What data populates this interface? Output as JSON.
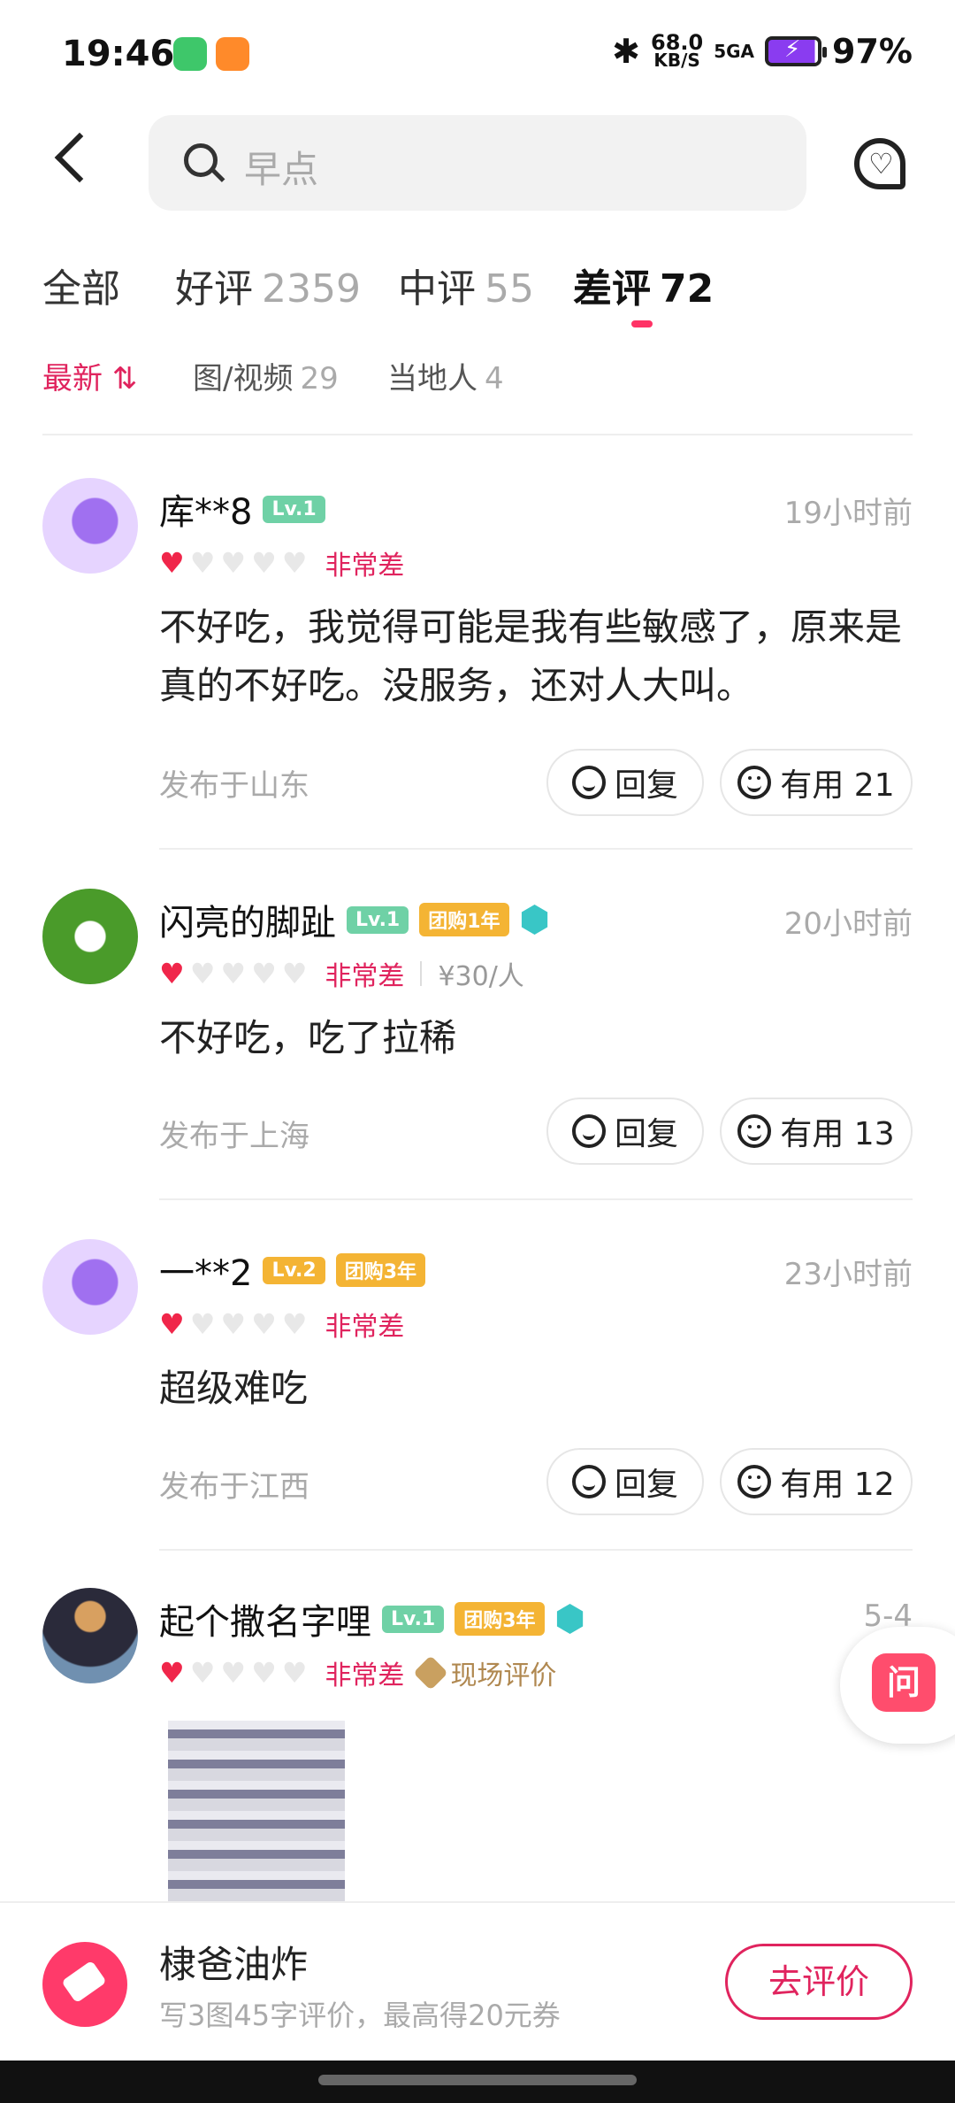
{
  "status_bar": {
    "time": "19:46",
    "net_speed": "68.0",
    "net_unit": "KB/S",
    "signal": "5GA",
    "battery": "97%"
  },
  "header": {
    "search_placeholder": "早点"
  },
  "tabs": [
    {
      "label": "全部",
      "count": ""
    },
    {
      "label": "好评",
      "count": "2359"
    },
    {
      "label": "中评",
      "count": "55"
    },
    {
      "label": "差评",
      "count": "72"
    }
  ],
  "filters": [
    {
      "label": "最新",
      "count": ""
    },
    {
      "label": "图/视频",
      "count": "29"
    },
    {
      "label": "当地人",
      "count": "4"
    }
  ],
  "reviews": [
    {
      "name": "库**8",
      "level": "Lv.1",
      "tenure": "",
      "time": "19小时前",
      "stars": 1,
      "rating": "非常差",
      "price": "",
      "scene": "",
      "content": "不好吃，我觉得可能是我有些敏感了，原来是真的不好吃。没服务，还对人大叫。",
      "location": "发布于山东",
      "reply_label": "回复",
      "useful_label": "有用 21"
    },
    {
      "name": "闪亮的脚趾",
      "level": "Lv.1",
      "tenure": "团购1年",
      "time": "20小时前",
      "stars": 1,
      "rating": "非常差",
      "price": "¥30/人",
      "scene": "",
      "content": "不好吃，吃了拉稀",
      "location": "发布于上海",
      "reply_label": "回复",
      "useful_label": "有用 13"
    },
    {
      "name": "一**2",
      "level": "Lv.2",
      "tenure": "团购3年",
      "time": "23小时前",
      "stars": 1,
      "rating": "非常差",
      "price": "",
      "scene": "",
      "content": "超级难吃",
      "location": "发布于江西",
      "reply_label": "回复",
      "useful_label": "有用 12"
    },
    {
      "name": "起个撒名字哩",
      "level": "Lv.1",
      "tenure": "团购3年",
      "time": "5-4",
      "stars": 1,
      "rating": "非常差",
      "price": "",
      "scene": "现场评价",
      "content": "",
      "location": "",
      "reply_label": "",
      "useful_label": ""
    }
  ],
  "float_ask": {
    "label": "问"
  },
  "bottom_bar": {
    "shop_name": "棣爸油炸",
    "subtitle": "写3图45字评价，最高得20元券",
    "button": "去评价"
  },
  "colors": {
    "accent": "#e0245e",
    "star_on": "#f0264a",
    "lv1": "#6fd1a6",
    "gold": "#f4b434"
  }
}
